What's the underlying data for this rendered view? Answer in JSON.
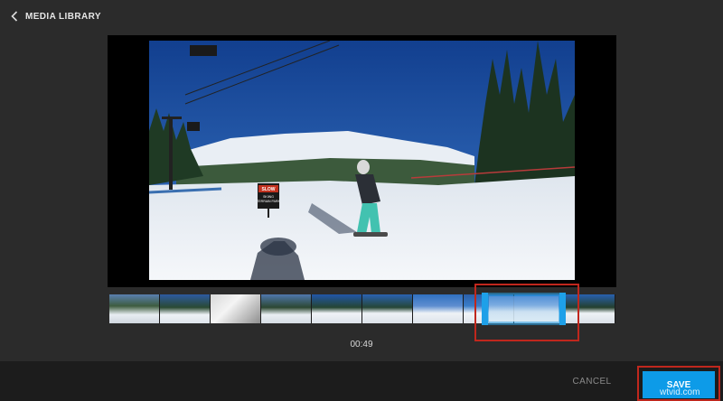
{
  "header": {
    "back_label": "MEDIA LIBRARY"
  },
  "player": {
    "sign_lines": [
      "SLOW",
      "SKIING",
      "TERRAIN PARK"
    ]
  },
  "timeline": {
    "current_time": "00:49",
    "selection_accent": "#1ea0e8",
    "highlight_color": "#c0271d"
  },
  "footer": {
    "cancel_label": "CANCEL",
    "save_label": "SAVE",
    "save_color": "#0d9be8"
  },
  "watermark": "wtvid.com"
}
